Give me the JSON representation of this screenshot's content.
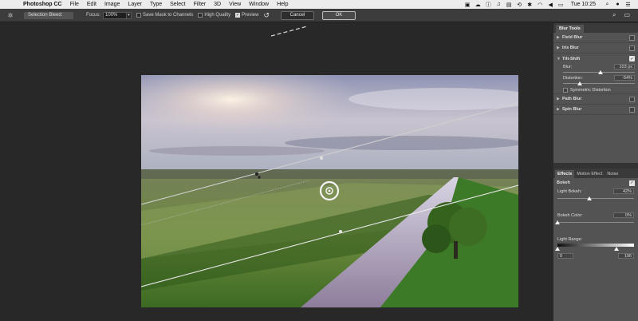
{
  "menubar": {
    "apple_icon": "apple-icon",
    "app_name": "Photoshop CC",
    "items": [
      "File",
      "Edit",
      "Image",
      "Layer",
      "Type",
      "Select",
      "Filter",
      "3D",
      "View",
      "Window",
      "Help"
    ],
    "clock": "Tue 10:25"
  },
  "options": {
    "selection_bleed_label": "Selection Bleed:",
    "focus_label": "Focus:",
    "focus_value": "100%",
    "save_mask_label": "Save Mask to Channels",
    "high_quality_label": "High Quality",
    "preview_label": "Preview",
    "preview_checked": true,
    "cancel_label": "Cancel",
    "ok_label": "OK"
  },
  "blur_tools": {
    "title": "Blur Tools",
    "field_blur": "Field Blur",
    "iris_blur": "Iris Blur",
    "tilt_shift": "Tilt-Shift",
    "tilt_shift_enabled": true,
    "blur_label": "Blur:",
    "blur_value": "103 px",
    "blur_level_fraction": 0.52,
    "distortion_label": "Distortion:",
    "distortion_value": "-54%",
    "distortion_level_fraction": 0.23,
    "symmetric_label": "Symmetric Distortion",
    "path_blur": "Path Blur",
    "spin_blur": "Spin Blur"
  },
  "effects": {
    "tabs": [
      "Effects",
      "Motion Effect",
      "Noise"
    ],
    "bokeh_label": "Bokeh",
    "bokeh_enabled": true,
    "light_bokeh_label": "Light Bokeh:",
    "light_bokeh_value": "42%",
    "light_bokeh_fraction": 0.42,
    "bokeh_color_label": "Bokeh Color:",
    "bokeh_color_value": "0%",
    "bokeh_color_fraction": 0.0,
    "light_range_label": "Light Range:",
    "light_range_min": "0",
    "light_range_max": "196",
    "light_range_min_fraction": 0.0,
    "light_range_max_fraction": 0.77
  }
}
